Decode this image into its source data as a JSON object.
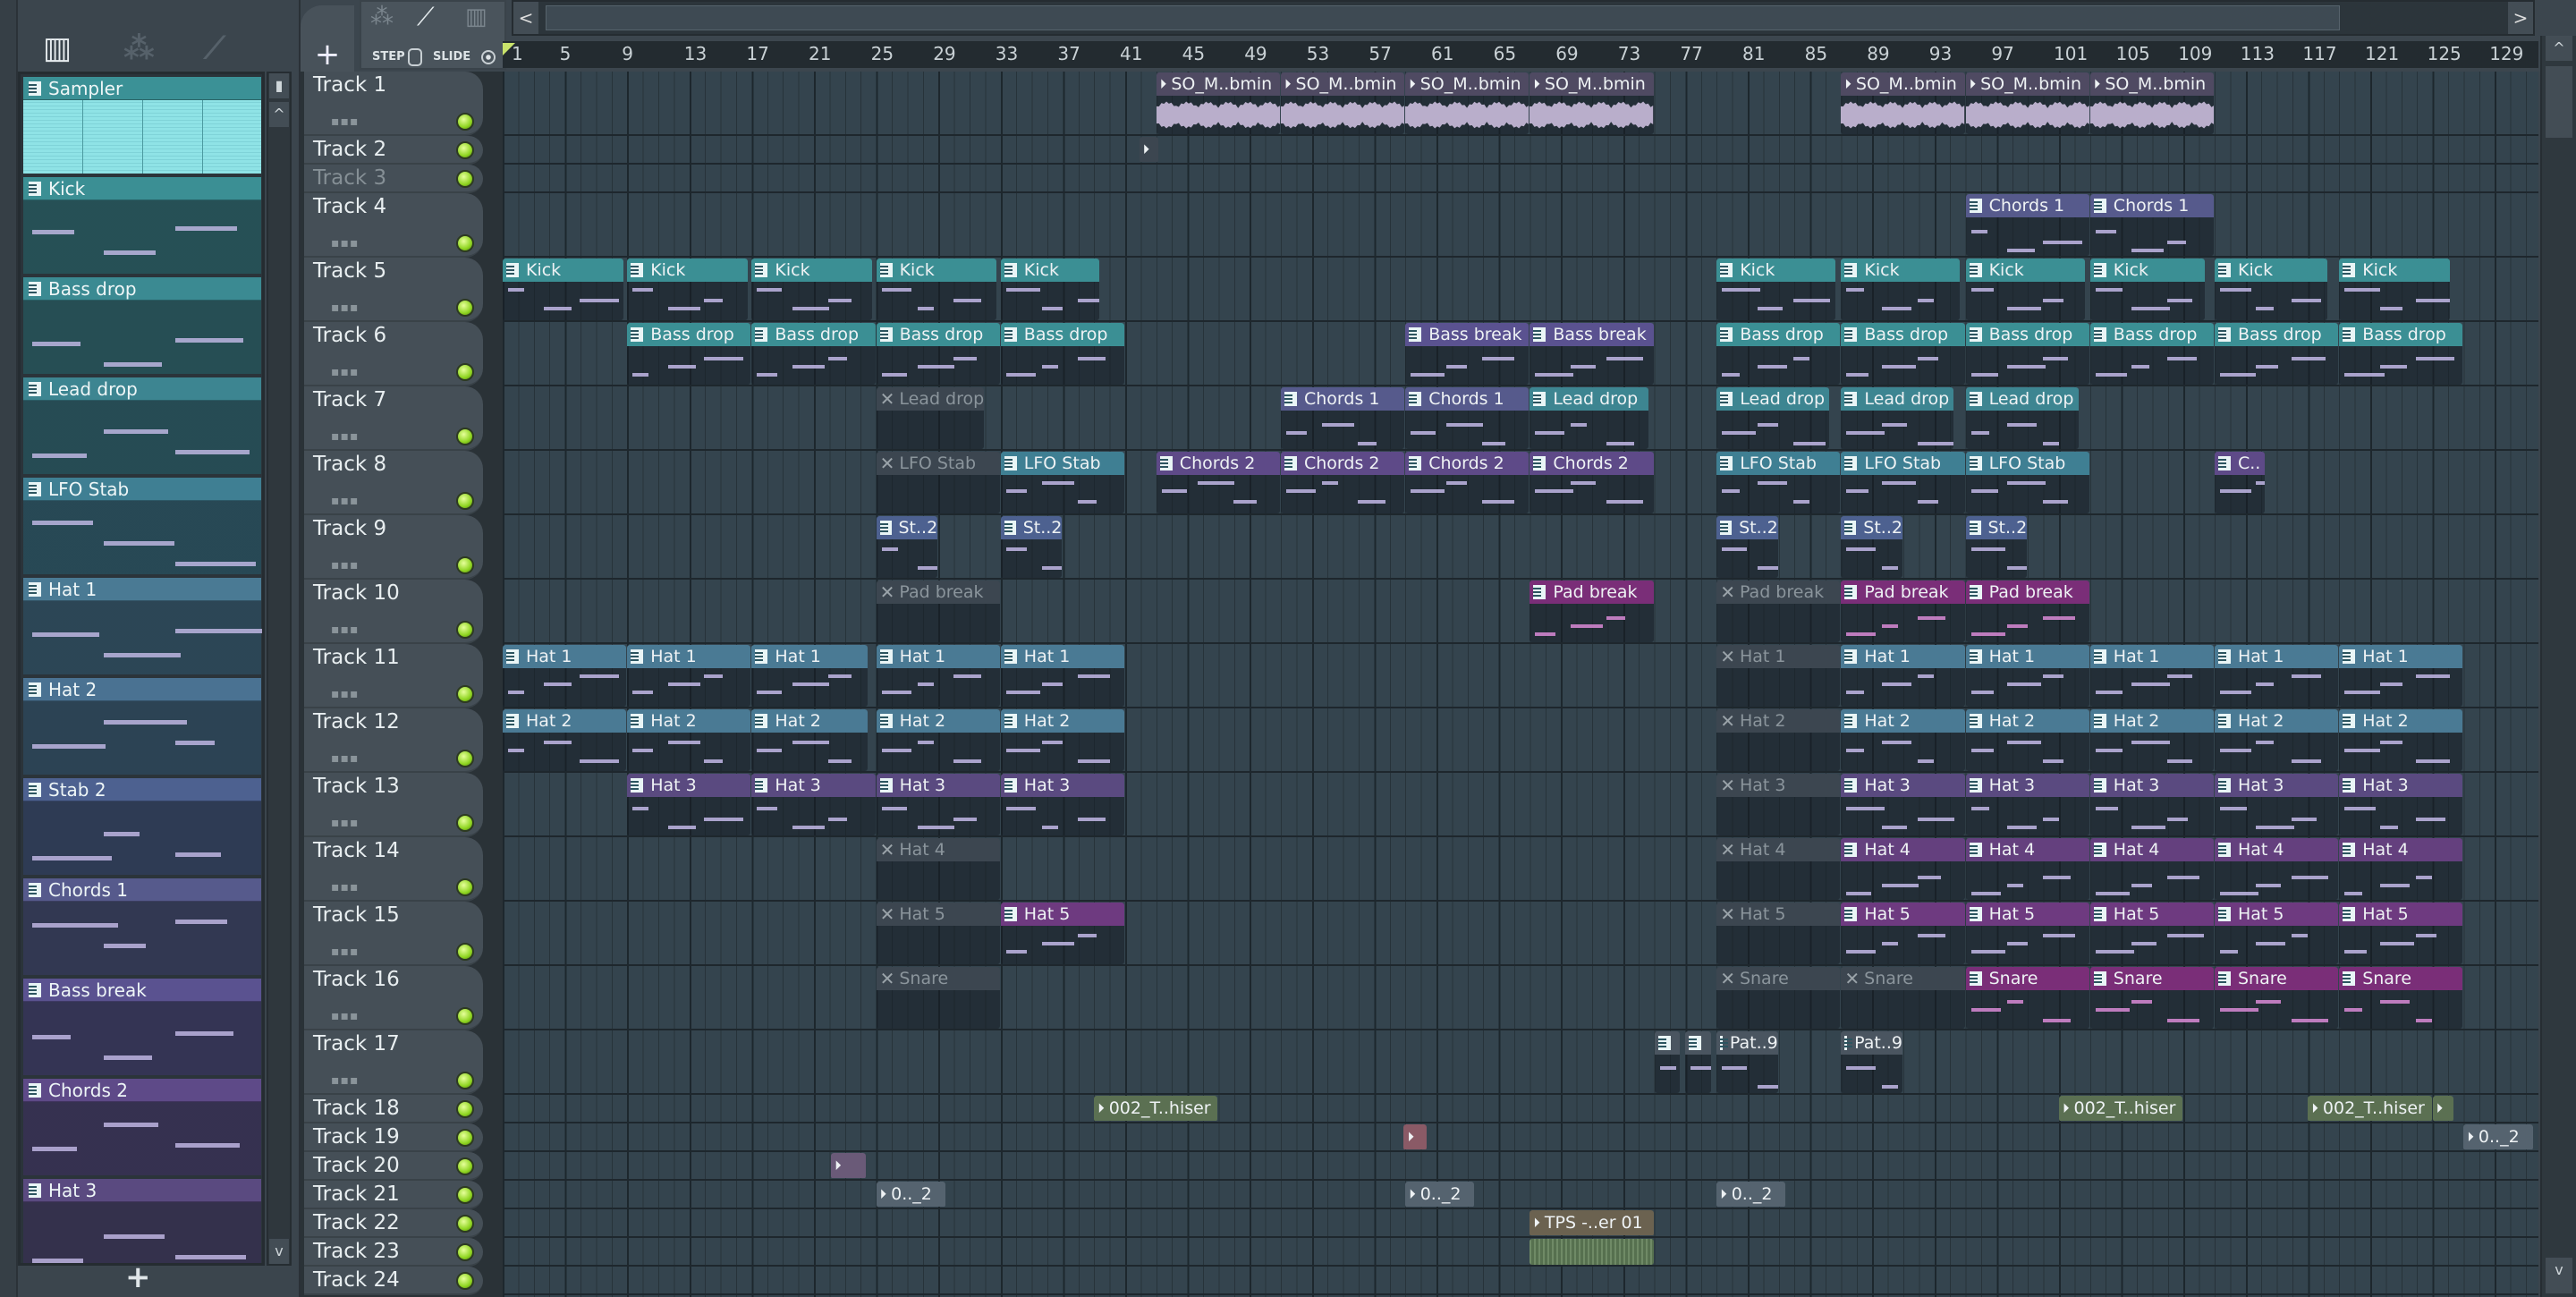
{
  "toolbar": {
    "step_label": "STEP",
    "slide_label": "SLIDE",
    "add_label": "+",
    "scroll_left": "<",
    "scroll_right": ">",
    "scroll_up": "^",
    "scroll_down": "v"
  },
  "icons": [
    "piano-roll-icon",
    "audio-wave-icon",
    "automation-icon"
  ],
  "picker": {
    "add_label": "+",
    "items": [
      {
        "name": "Sampler",
        "color": "#3b9196",
        "kind": "audio"
      },
      {
        "name": "Kick",
        "color": "#3b8f94"
      },
      {
        "name": "Bass drop",
        "color": "#3b8a92"
      },
      {
        "name": "Lead drop",
        "color": "#3d8591"
      },
      {
        "name": "LFO Stab",
        "color": "#3f7f93"
      },
      {
        "name": "Hat 1",
        "color": "#4a7a94"
      },
      {
        "name": "Hat 2",
        "color": "#4a7292"
      },
      {
        "name": "Stab 2",
        "color": "#4d6190"
      },
      {
        "name": "Chords 1",
        "color": "#565a8c"
      },
      {
        "name": "Bass break",
        "color": "#5a5290"
      },
      {
        "name": "Chords 2",
        "color": "#5e4a88"
      },
      {
        "name": "Hat 3",
        "color": "#5a4a80"
      }
    ]
  },
  "ruler": {
    "bars": [
      "1",
      "5",
      "9",
      "13",
      "17",
      "21",
      "25",
      "29",
      "33",
      "37",
      "41",
      "45",
      "49",
      "53",
      "57",
      "61",
      "65",
      "69",
      "73",
      "77",
      "81",
      "85",
      "89",
      "93",
      "97",
      "101",
      "105",
      "109",
      "113",
      "117",
      "121",
      "125",
      "129"
    ]
  },
  "colors": {
    "kick": "#3b8f94",
    "lead": "#3d8591",
    "lfo": "#3f7f93",
    "hat": "#4a7a94",
    "stab": "#4d6190",
    "chords1": "#565a8c",
    "bassbreak": "#5a5290",
    "chords2": "#5e4a88",
    "hat3": "#5a4a80",
    "hat4": "#64407e",
    "hat5": "#6e3a80",
    "pink": "#7a2e78",
    "muted": "#3c4650",
    "audio": "#4f4a62",
    "green": "#5b7052",
    "pat": "#4a5560",
    "tps": "#6b6250",
    "pinkaud": "#8a5a66",
    "purpaud": "#6a5a78",
    "blueaud": "#55636f"
  },
  "tracks": [
    {
      "name": "Track 1",
      "size": "L",
      "clips": [
        {
          "n": "SO_M..bmin",
          "s": 43,
          "l": 8,
          "c": "audio",
          "a": 1,
          "w": 1
        },
        {
          "n": "SO_M..bmin",
          "s": 51,
          "l": 8,
          "c": "audio",
          "a": 1,
          "w": 1
        },
        {
          "n": "SO_M..bmin",
          "s": 59,
          "l": 8,
          "c": "audio",
          "a": 1,
          "w": 1
        },
        {
          "n": "SO_M..bmin",
          "s": 67,
          "l": 8,
          "c": "audio",
          "a": 1,
          "w": 1
        },
        {
          "n": "SO_M..bmin",
          "s": 87,
          "l": 8,
          "c": "audio",
          "a": 1,
          "w": 1
        },
        {
          "n": "SO_M..bmin",
          "s": 95,
          "l": 8,
          "c": "audio",
          "a": 1,
          "w": 1
        },
        {
          "n": "SO_M..bmin",
          "s": 103,
          "l": 8,
          "c": "audio",
          "a": 1,
          "w": 1
        }
      ]
    },
    {
      "name": "Track 2",
      "size": "S",
      "clips": [
        {
          "n": "",
          "s": 41.9,
          "l": 1.3,
          "c": "muted",
          "a": 1
        }
      ]
    },
    {
      "name": "Track 3",
      "size": "S",
      "dim": 1,
      "clips": []
    },
    {
      "name": "Track 4",
      "size": "L",
      "clips": [
        {
          "n": "Chords 1",
          "s": 95,
          "l": 8,
          "c": "chords1"
        },
        {
          "n": "Chords 1",
          "s": 103,
          "l": 8,
          "c": "chords1"
        }
      ]
    },
    {
      "name": "Track 5",
      "size": "L",
      "clips": [
        {
          "n": "Kick",
          "s": 1,
          "l": 7.8,
          "c": "kick"
        },
        {
          "n": "Kick",
          "s": 9,
          "l": 7.8,
          "c": "kick"
        },
        {
          "n": "Kick",
          "s": 17,
          "l": 7.8,
          "c": "kick"
        },
        {
          "n": "Kick",
          "s": 25,
          "l": 7.8,
          "c": "kick"
        },
        {
          "n": "Kick",
          "s": 33,
          "l": 6.4,
          "c": "kick"
        },
        {
          "n": "Kick",
          "s": 79,
          "l": 7.7,
          "c": "kick"
        },
        {
          "n": "Kick",
          "s": 87,
          "l": 7.7,
          "c": "kick"
        },
        {
          "n": "Kick",
          "s": 95,
          "l": 7.7,
          "c": "kick"
        },
        {
          "n": "Kick",
          "s": 103,
          "l": 7.4,
          "c": "kick"
        },
        {
          "n": "Kick",
          "s": 111,
          "l": 7.3,
          "c": "kick"
        },
        {
          "n": "Kick",
          "s": 119,
          "l": 7.2,
          "c": "kick"
        }
      ]
    },
    {
      "name": "Track 6",
      "size": "L",
      "clips": [
        {
          "n": "Bass drop",
          "s": 9,
          "l": 8,
          "c": "kick"
        },
        {
          "n": "Bass drop",
          "s": 17,
          "l": 8,
          "c": "kick"
        },
        {
          "n": "Bass drop",
          "s": 25,
          "l": 8,
          "c": "kick"
        },
        {
          "n": "Bass drop",
          "s": 33,
          "l": 8,
          "c": "kick"
        },
        {
          "n": "Bass break",
          "s": 59,
          "l": 8,
          "c": "bassbreak"
        },
        {
          "n": "Bass break",
          "s": 67,
          "l": 8,
          "c": "bassbreak"
        },
        {
          "n": "Bass drop",
          "s": 79,
          "l": 8,
          "c": "kick"
        },
        {
          "n": "Bass drop",
          "s": 87,
          "l": 8,
          "c": "kick"
        },
        {
          "n": "Bass drop",
          "s": 95,
          "l": 8,
          "c": "kick"
        },
        {
          "n": "Bass drop",
          "s": 103,
          "l": 8,
          "c": "kick"
        },
        {
          "n": "Bass drop",
          "s": 111,
          "l": 8,
          "c": "kick"
        },
        {
          "n": "Bass drop",
          "s": 119,
          "l": 8,
          "c": "kick"
        }
      ]
    },
    {
      "name": "Track 7",
      "size": "L",
      "clips": [
        {
          "n": "Lead drop",
          "s": 25,
          "l": 7,
          "c": "muted",
          "m": 1
        },
        {
          "n": "Chords 1",
          "s": 51,
          "l": 8,
          "c": "chords1"
        },
        {
          "n": "Chords 1",
          "s": 59,
          "l": 8,
          "c": "chords1"
        },
        {
          "n": "Lead drop",
          "s": 67,
          "l": 7.7,
          "c": "lead"
        },
        {
          "n": "Lead drop",
          "s": 79,
          "l": 7.3,
          "c": "lead"
        },
        {
          "n": "Lead drop",
          "s": 87,
          "l": 7.3,
          "c": "lead"
        },
        {
          "n": "Lead drop",
          "s": 95,
          "l": 7.3,
          "c": "lead"
        }
      ]
    },
    {
      "name": "Track 8",
      "size": "L",
      "clips": [
        {
          "n": "LFO Stab",
          "s": 25,
          "l": 8,
          "c": "muted",
          "m": 1
        },
        {
          "n": "LFO Stab",
          "s": 33,
          "l": 8,
          "c": "lfo"
        },
        {
          "n": "Chords 2",
          "s": 43,
          "l": 8,
          "c": "chords2"
        },
        {
          "n": "Chords 2",
          "s": 51,
          "l": 8,
          "c": "chords2"
        },
        {
          "n": "Chords 2",
          "s": 59,
          "l": 8,
          "c": "chords2"
        },
        {
          "n": "Chords 2",
          "s": 67,
          "l": 8,
          "c": "chords2"
        },
        {
          "n": "LFO Stab",
          "s": 79,
          "l": 8,
          "c": "lfo"
        },
        {
          "n": "LFO Stab",
          "s": 87,
          "l": 8,
          "c": "lfo"
        },
        {
          "n": "LFO Stab",
          "s": 95,
          "l": 8,
          "c": "lfo"
        },
        {
          "n": "C..",
          "s": 111,
          "l": 3.3,
          "c": "chords2"
        }
      ]
    },
    {
      "name": "Track 9",
      "size": "L",
      "clips": [
        {
          "n": "St..2",
          "s": 25,
          "l": 4,
          "c": "stab"
        },
        {
          "n": "St..2",
          "s": 33,
          "l": 4,
          "c": "stab"
        },
        {
          "n": "St..2",
          "s": 79,
          "l": 4,
          "c": "stab"
        },
        {
          "n": "St..2",
          "s": 87,
          "l": 4,
          "c": "stab"
        },
        {
          "n": "St..2",
          "s": 95,
          "l": 4,
          "c": "stab"
        }
      ]
    },
    {
      "name": "Track 10",
      "size": "L",
      "clips": [
        {
          "n": "Pad break",
          "s": 25,
          "l": 8,
          "c": "muted",
          "m": 1
        },
        {
          "n": "Pad break",
          "s": 67,
          "l": 8,
          "c": "pink"
        },
        {
          "n": "Pad break",
          "s": 79,
          "l": 8,
          "c": "muted",
          "m": 1
        },
        {
          "n": "Pad break",
          "s": 87,
          "l": 8,
          "c": "pink"
        },
        {
          "n": "Pad break",
          "s": 95,
          "l": 8,
          "c": "pink"
        }
      ]
    },
    {
      "name": "Track 11",
      "size": "L",
      "clips": [
        {
          "n": "Hat 1",
          "s": 1,
          "l": 8,
          "c": "hat"
        },
        {
          "n": "Hat 1",
          "s": 9,
          "l": 8,
          "c": "hat"
        },
        {
          "n": "Hat 1",
          "s": 17,
          "l": 7.5,
          "c": "hat"
        },
        {
          "n": "Hat 1",
          "s": 25,
          "l": 8,
          "c": "hat"
        },
        {
          "n": "Hat 1",
          "s": 33,
          "l": 8,
          "c": "hat"
        },
        {
          "n": "Hat 1",
          "s": 79,
          "l": 8,
          "c": "muted",
          "m": 1
        },
        {
          "n": "Hat 1",
          "s": 87,
          "l": 8,
          "c": "hat"
        },
        {
          "n": "Hat 1",
          "s": 95,
          "l": 8,
          "c": "hat"
        },
        {
          "n": "Hat 1",
          "s": 103,
          "l": 8,
          "c": "hat"
        },
        {
          "n": "Hat 1",
          "s": 111,
          "l": 8,
          "c": "hat"
        },
        {
          "n": "Hat 1",
          "s": 119,
          "l": 8,
          "c": "hat"
        }
      ]
    },
    {
      "name": "Track 12",
      "size": "L",
      "clips": [
        {
          "n": "Hat 2",
          "s": 1,
          "l": 8,
          "c": "hat"
        },
        {
          "n": "Hat 2",
          "s": 9,
          "l": 8,
          "c": "hat"
        },
        {
          "n": "Hat 2",
          "s": 17,
          "l": 7.5,
          "c": "hat"
        },
        {
          "n": "Hat 2",
          "s": 25,
          "l": 8,
          "c": "hat"
        },
        {
          "n": "Hat 2",
          "s": 33,
          "l": 8,
          "c": "hat"
        },
        {
          "n": "Hat 2",
          "s": 79,
          "l": 8,
          "c": "muted",
          "m": 1
        },
        {
          "n": "Hat 2",
          "s": 87,
          "l": 8,
          "c": "hat"
        },
        {
          "n": "Hat 2",
          "s": 95,
          "l": 8,
          "c": "hat"
        },
        {
          "n": "Hat 2",
          "s": 103,
          "l": 8,
          "c": "hat"
        },
        {
          "n": "Hat 2",
          "s": 111,
          "l": 8,
          "c": "hat"
        },
        {
          "n": "Hat 2",
          "s": 119,
          "l": 8,
          "c": "hat"
        }
      ]
    },
    {
      "name": "Track 13",
      "size": "L",
      "clips": [
        {
          "n": "Hat 3",
          "s": 9,
          "l": 8,
          "c": "hat3"
        },
        {
          "n": "Hat 3",
          "s": 17,
          "l": 8,
          "c": "hat3"
        },
        {
          "n": "Hat 3",
          "s": 25,
          "l": 8,
          "c": "hat3"
        },
        {
          "n": "Hat 3",
          "s": 33,
          "l": 8,
          "c": "hat3"
        },
        {
          "n": "Hat 3",
          "s": 79,
          "l": 8,
          "c": "muted",
          "m": 1
        },
        {
          "n": "Hat 3",
          "s": 87,
          "l": 8,
          "c": "hat3"
        },
        {
          "n": "Hat 3",
          "s": 95,
          "l": 8,
          "c": "hat3"
        },
        {
          "n": "Hat 3",
          "s": 103,
          "l": 8,
          "c": "hat3"
        },
        {
          "n": "Hat 3",
          "s": 111,
          "l": 8,
          "c": "hat3"
        },
        {
          "n": "Hat 3",
          "s": 119,
          "l": 8,
          "c": "hat3"
        }
      ]
    },
    {
      "name": "Track 14",
      "size": "L",
      "clips": [
        {
          "n": "Hat 4",
          "s": 25,
          "l": 8,
          "c": "muted",
          "m": 1
        },
        {
          "n": "Hat 4",
          "s": 79,
          "l": 8,
          "c": "muted",
          "m": 1
        },
        {
          "n": "Hat 4",
          "s": 87,
          "l": 8,
          "c": "hat4"
        },
        {
          "n": "Hat 4",
          "s": 95,
          "l": 8,
          "c": "hat4"
        },
        {
          "n": "Hat 4",
          "s": 103,
          "l": 8,
          "c": "hat4"
        },
        {
          "n": "Hat 4",
          "s": 111,
          "l": 8,
          "c": "hat4"
        },
        {
          "n": "Hat 4",
          "s": 119,
          "l": 8,
          "c": "hat4"
        }
      ]
    },
    {
      "name": "Track 15",
      "size": "L",
      "clips": [
        {
          "n": "Hat 5",
          "s": 25,
          "l": 8,
          "c": "muted",
          "m": 1
        },
        {
          "n": "Hat 5",
          "s": 33,
          "l": 8,
          "c": "hat5"
        },
        {
          "n": "Hat 5",
          "s": 79,
          "l": 8,
          "c": "muted",
          "m": 1
        },
        {
          "n": "Hat 5",
          "s": 87,
          "l": 8,
          "c": "hat5"
        },
        {
          "n": "Hat 5",
          "s": 95,
          "l": 8,
          "c": "hat5"
        },
        {
          "n": "Hat 5",
          "s": 103,
          "l": 8,
          "c": "hat5"
        },
        {
          "n": "Hat 5",
          "s": 111,
          "l": 8,
          "c": "hat5"
        },
        {
          "n": "Hat 5",
          "s": 119,
          "l": 8,
          "c": "hat5"
        }
      ]
    },
    {
      "name": "Track 16",
      "size": "L",
      "clips": [
        {
          "n": "Snare",
          "s": 25,
          "l": 8,
          "c": "muted",
          "m": 1
        },
        {
          "n": "Snare",
          "s": 79,
          "l": 8,
          "c": "muted",
          "m": 1
        },
        {
          "n": "Snare",
          "s": 87,
          "l": 8,
          "c": "muted",
          "m": 1
        },
        {
          "n": "Snare",
          "s": 95,
          "l": 8,
          "c": "pink"
        },
        {
          "n": "Snare",
          "s": 103,
          "l": 8,
          "c": "pink"
        },
        {
          "n": "Snare",
          "s": 111,
          "l": 8,
          "c": "pink"
        },
        {
          "n": "Snare",
          "s": 119,
          "l": 8,
          "c": "pink"
        }
      ]
    },
    {
      "name": "Track 17",
      "size": "L",
      "clips": [
        {
          "n": "",
          "s": 75,
          "l": 1.7,
          "c": "pat"
        },
        {
          "n": "",
          "s": 77,
          "l": 1.7,
          "c": "pat"
        },
        {
          "n": "Pat..9",
          "s": 79,
          "l": 4,
          "c": "pat"
        },
        {
          "n": "Pat..9",
          "s": 87,
          "l": 4,
          "c": "pat"
        }
      ]
    },
    {
      "name": "Track 18",
      "size": "S",
      "clips": [
        {
          "n": "002_T..hiser",
          "s": 39,
          "l": 8,
          "c": "green",
          "a": 1
        },
        {
          "n": "002_T..hiser",
          "s": 101,
          "l": 8,
          "c": "green",
          "a": 1
        },
        {
          "n": "002_T..hiser",
          "s": 117,
          "l": 8,
          "c": "green",
          "a": 1
        },
        {
          "n": "",
          "s": 125,
          "l": 1.4,
          "c": "green",
          "a": 1
        }
      ]
    },
    {
      "name": "Track 19",
      "size": "S",
      "clips": [
        {
          "n": "",
          "s": 58.9,
          "l": 1.5,
          "c": "pinkaud",
          "a": 1
        },
        {
          "n": "0.._2",
          "s": 127,
          "l": 4.5,
          "c": "blueaud",
          "a": 1
        }
      ]
    },
    {
      "name": "Track 20",
      "size": "S",
      "clips": [
        {
          "n": "",
          "s": 22.1,
          "l": 2.3,
          "c": "purpaud",
          "a": 1
        }
      ]
    },
    {
      "name": "Track 21",
      "size": "S",
      "clips": [
        {
          "n": "0.._2",
          "s": 25,
          "l": 4.5,
          "c": "blueaud",
          "a": 1
        },
        {
          "n": "0.._2",
          "s": 59,
          "l": 4.5,
          "c": "blueaud",
          "a": 1
        },
        {
          "n": "0.._2",
          "s": 79,
          "l": 4.5,
          "c": "blueaud",
          "a": 1
        }
      ]
    },
    {
      "name": "Track 22",
      "size": "S",
      "clips": [
        {
          "n": "TPS -..er 01",
          "s": 67,
          "l": 8,
          "c": "tps",
          "a": 1
        }
      ]
    },
    {
      "name": "Track 23",
      "size": "S",
      "clips": [
        {
          "n": "",
          "s": 67,
          "l": 8,
          "c": "green",
          "body": 1
        }
      ]
    },
    {
      "name": "Track 24",
      "size": "S",
      "clips": []
    }
  ]
}
